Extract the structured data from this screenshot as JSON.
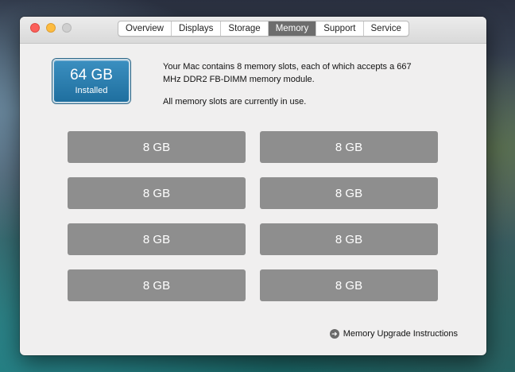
{
  "tabs": [
    {
      "label": "Overview"
    },
    {
      "label": "Displays"
    },
    {
      "label": "Storage"
    },
    {
      "label": "Memory"
    },
    {
      "label": "Support"
    },
    {
      "label": "Service"
    }
  ],
  "active_tab": "Memory",
  "summary": {
    "amount": "64 GB",
    "caption": "Installed"
  },
  "description": {
    "line1": "Your Mac contains 8 memory slots, each of which accepts a 667 MHz DDR2 FB-DIMM memory module.",
    "line2": "All memory slots are currently in use."
  },
  "slots": [
    "8 GB",
    "8 GB",
    "8 GB",
    "8 GB",
    "8 GB",
    "8 GB",
    "8 GB",
    "8 GB"
  ],
  "upgrade_link": "Memory Upgrade Instructions",
  "colors": {
    "summary_blue": "#1f6f9f",
    "slot_gray": "#8e8e8e",
    "active_tab": "#6d6d6d"
  }
}
